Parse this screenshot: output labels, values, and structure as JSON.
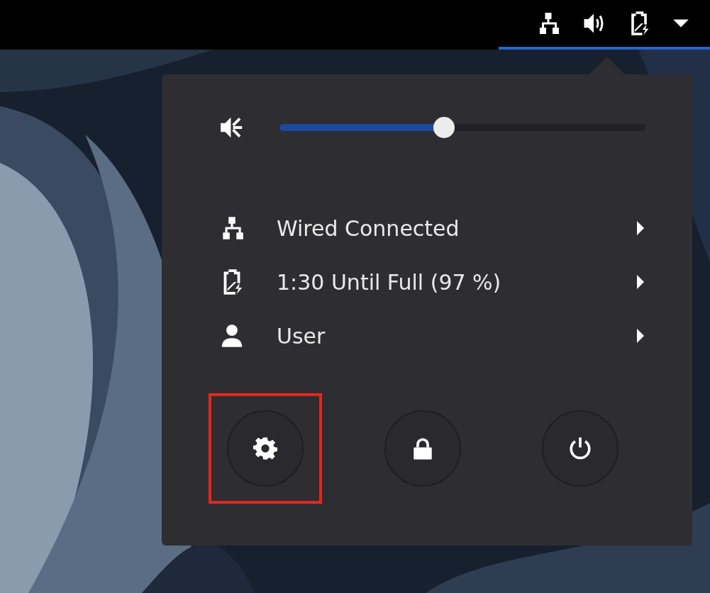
{
  "top_bar": {
    "indicators": [
      {
        "kind": "network"
      },
      {
        "kind": "volume"
      },
      {
        "kind": "battery"
      },
      {
        "kind": "dropdown"
      }
    ],
    "active": true
  },
  "menu": {
    "volume": {
      "level": 0.45
    },
    "items": [
      {
        "kind": "network",
        "label": "Wired Connected"
      },
      {
        "kind": "battery",
        "label": "1:30 Until Full (97 %)"
      },
      {
        "kind": "user",
        "label": "User"
      }
    ],
    "buttons": [
      {
        "kind": "settings",
        "highlighted": true
      },
      {
        "kind": "lock",
        "highlighted": false
      },
      {
        "kind": "power",
        "highlighted": false
      }
    ]
  }
}
